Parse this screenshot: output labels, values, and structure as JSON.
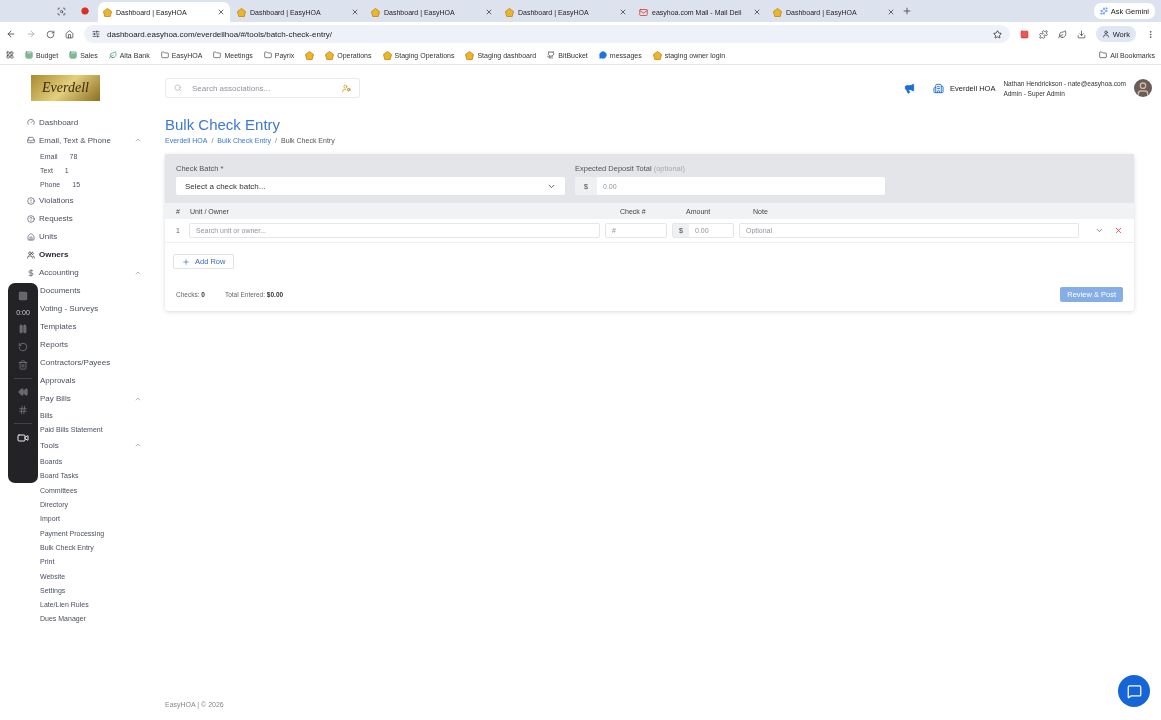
{
  "browser": {
    "pinned": [
      {
        "kind": "search"
      },
      {
        "kind": "record"
      }
    ],
    "tabs": [
      {
        "title": "Dashboard | EasyHOA",
        "kind": "site",
        "selected": true
      },
      {
        "title": "Dashboard | EasyHOA",
        "kind": "site",
        "selected": false
      },
      {
        "title": "Dashboard | EasyHOA",
        "kind": "site",
        "selected": false
      },
      {
        "title": "Dashboard | EasyHOA",
        "kind": "site",
        "selected": false
      },
      {
        "title": "easyhoa.com Mail - Mail Deli",
        "kind": "mail",
        "selected": false
      },
      {
        "title": "Dashboard | EasyHOA",
        "kind": "site",
        "selected": false
      }
    ],
    "gemini": "Ask Gemini",
    "url": "dashboard.easyhoa.com/everdellhoa/#/tools/batch-check-entry/",
    "profile": "Work",
    "bookmarks": [
      {
        "label": "Budget",
        "kind": "sheet"
      },
      {
        "label": "Sales",
        "kind": "sheet"
      },
      {
        "label": "Alta Bank",
        "kind": "site"
      },
      {
        "label": "EasyHOA",
        "kind": "folder"
      },
      {
        "label": "Meetings",
        "kind": "folder"
      },
      {
        "label": "Payrix",
        "kind": "folder"
      },
      {
        "kind": "hoa"
      },
      {
        "label": "Operations",
        "kind": "hoa"
      },
      {
        "label": "Staging Operations",
        "kind": "hoa"
      },
      {
        "label": "Staging dashboard",
        "kind": "hoa"
      },
      {
        "label": "BitBucket",
        "kind": "dark"
      },
      {
        "label": "messages",
        "kind": "chat"
      },
      {
        "label": "staging owner login",
        "kind": "hoa"
      }
    ],
    "all_bookmarks": "All Bookmarks"
  },
  "sidebar": {
    "logo": "Everdell",
    "items": [
      {
        "label": "Dashboard",
        "selected": false
      },
      {
        "label": "Email, Text & Phone",
        "selected": false,
        "expanded": true,
        "children": [
          {
            "label": "Email",
            "count": "78"
          },
          {
            "label": "Text",
            "count": "1"
          },
          {
            "label": "Phone",
            "count": "15"
          }
        ]
      },
      {
        "label": "Violations",
        "selected": false
      },
      {
        "label": "Requests",
        "selected": false
      },
      {
        "label": "Units",
        "selected": false
      },
      {
        "label": "Owners",
        "selected": true
      },
      {
        "label": "Accounting",
        "selected": false,
        "expanded": true
      },
      {
        "label": "Documents",
        "selected": false
      },
      {
        "label": "Voting - Surveys",
        "selected": false
      },
      {
        "label": "Templates",
        "selected": false
      },
      {
        "label": "Reports",
        "selected": false
      },
      {
        "label": "Contractors/Payees",
        "selected": false
      },
      {
        "label": "Approvals",
        "selected": false
      },
      {
        "label": "Pay Bills",
        "selected": false,
        "expanded": true,
        "children": [
          {
            "label": "Bills"
          },
          {
            "label": "Paid Bills Statement"
          }
        ]
      },
      {
        "label": "Tools",
        "selected": false,
        "expanded": true,
        "children": [
          {
            "label": "Boards"
          },
          {
            "label": "Board Tasks"
          },
          {
            "label": "Committees"
          },
          {
            "label": "Directory"
          },
          {
            "label": "Import"
          },
          {
            "label": "Payment Processing"
          },
          {
            "label": "Bulk Check Entry"
          },
          {
            "label": "Print"
          },
          {
            "label": "Website"
          },
          {
            "label": "Settings"
          },
          {
            "label": "Late/Lien Rules"
          },
          {
            "label": "Dues Manager"
          }
        ]
      }
    ]
  },
  "recorder": {
    "time": "0:00"
  },
  "header": {
    "search_placeholder": "Search associations...",
    "association": "Everdell HOA",
    "user": "Nathan Hendrickson - nate@easyhoa.com",
    "role": "Admin - Super Admin"
  },
  "page": {
    "title": "Bulk Check Entry",
    "breadcrumb_separator": "/",
    "breadcrumbs": [
      {
        "label": "Everdell HOA",
        "link": true
      },
      {
        "label": "Bulk Check Entry",
        "link": true
      },
      {
        "label": "Bulk Check Entry",
        "link": false
      }
    ],
    "form": {
      "batch_label": "Check Batch *",
      "batch_placeholder": "Select a check batch...",
      "deposit_label": "Expected Deposit Total",
      "deposit_hint": "(optional)",
      "currency": "$",
      "deposit_placeholder": "0.00"
    },
    "table": {
      "columns": [
        "#",
        "Unit / Owner",
        "Check #",
        "Amount",
        "Note"
      ],
      "rows": [
        {
          "number": "1",
          "unit_placeholder": "Search unit or owner...",
          "check_placeholder": "#",
          "currency": "$",
          "amount_placeholder": "0.00",
          "note_placeholder": "Optional"
        }
      ]
    },
    "add_row": "Add Row",
    "summary": {
      "checks_label": "Checks:",
      "checks": "0",
      "total_label": "Total Entered:",
      "total": "$0.00"
    },
    "submit": {
      "label": "Review & Post",
      "disabled": true
    }
  },
  "footer": "EasyHOA | © 2026"
}
